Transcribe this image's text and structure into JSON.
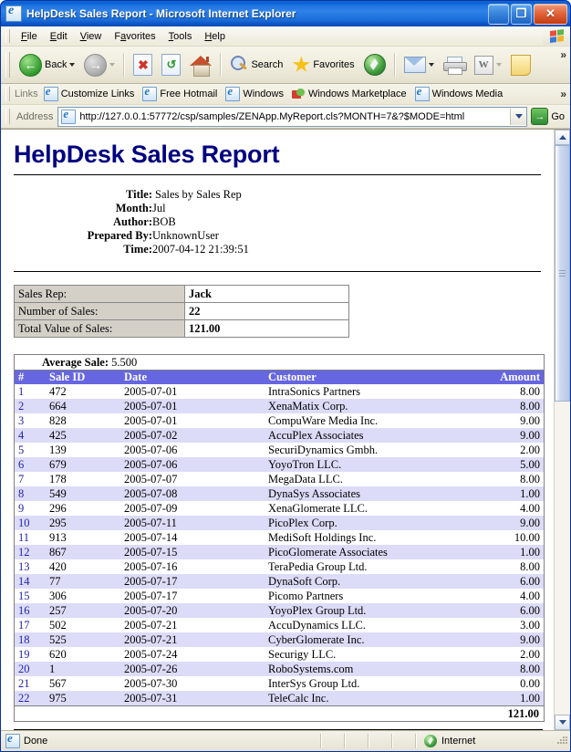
{
  "window": {
    "title": "HelpDesk Sales Report - Microsoft Internet Explorer",
    "minimize_label": "_",
    "maximize_label": "❐",
    "close_label": "✕"
  },
  "menubar": {
    "items": [
      {
        "label": "File",
        "accel": "F"
      },
      {
        "label": "Edit",
        "accel": "E"
      },
      {
        "label": "View",
        "accel": "V"
      },
      {
        "label": "Favorites",
        "accel": "a"
      },
      {
        "label": "Tools",
        "accel": "T"
      },
      {
        "label": "Help",
        "accel": "H"
      }
    ]
  },
  "linksbar": {
    "label": "Links",
    "items": [
      {
        "label": "Customize Links",
        "icon": "ie-page-icon"
      },
      {
        "label": "Free Hotmail",
        "icon": "ie-page-icon"
      },
      {
        "label": "Windows",
        "icon": "ie-page-icon"
      },
      {
        "label": "Windows Marketplace",
        "icon": "marketplace-icon"
      },
      {
        "label": "Windows Media",
        "icon": "ie-page-icon"
      }
    ],
    "overflow_label": "»"
  },
  "address": {
    "label": "Address",
    "url": "http://127.0.0.1:57772/csp/samples/ZENApp.MyReport.cls?MONTH=7&?$MODE=html",
    "go_label": "Go",
    "go_icon": "arrow-right-icon"
  },
  "toolbar": {
    "back_label": "Back",
    "search_label": "Search",
    "favorites_label": "Favorites",
    "overflow_label": "»"
  },
  "report": {
    "title": "HelpDesk Sales Report",
    "meta": [
      {
        "label": "Title:",
        "value": "Sales by Sales Rep"
      },
      {
        "label": "Month:",
        "value": "Jul"
      },
      {
        "label": "Author:",
        "value": "BOB"
      },
      {
        "label": "Prepared By:",
        "value": "UnknownUser"
      },
      {
        "label": "Time:",
        "value": "2007-04-12 21:39:51"
      }
    ],
    "summary": [
      {
        "key": "Sales Rep:",
        "value": "Jack"
      },
      {
        "key": "Number of Sales:",
        "value": "22"
      },
      {
        "key": "Total Value of Sales:",
        "value": "121.00"
      }
    ],
    "average_sale_label": "Average Sale:",
    "average_sale_value": "5.500",
    "columns": [
      "#",
      "Sale ID",
      "Date",
      "Customer",
      "Amount"
    ],
    "total_amount": "121.00",
    "header_bg": "#6666e0",
    "alt_row_bg": "#dcdcf8",
    "title_color": "#000080",
    "rows": [
      {
        "n": "1",
        "sale_id": "472",
        "date": "2005-07-01",
        "customer": "IntraSonics Partners",
        "amount": "8.00"
      },
      {
        "n": "2",
        "sale_id": "664",
        "date": "2005-07-01",
        "customer": "XenaMatix Corp.",
        "amount": "8.00"
      },
      {
        "n": "3",
        "sale_id": "828",
        "date": "2005-07-01",
        "customer": "CompuWare Media Inc.",
        "amount": "9.00"
      },
      {
        "n": "4",
        "sale_id": "425",
        "date": "2005-07-02",
        "customer": "AccuPlex Associates",
        "amount": "9.00"
      },
      {
        "n": "5",
        "sale_id": "139",
        "date": "2005-07-06",
        "customer": "SecuriDynamics Gmbh.",
        "amount": "2.00"
      },
      {
        "n": "6",
        "sale_id": "679",
        "date": "2005-07-06",
        "customer": "YoyoTron LLC.",
        "amount": "5.00"
      },
      {
        "n": "7",
        "sale_id": "178",
        "date": "2005-07-07",
        "customer": "MegaData LLC.",
        "amount": "8.00"
      },
      {
        "n": "8",
        "sale_id": "549",
        "date": "2005-07-08",
        "customer": "DynaSys Associates",
        "amount": "1.00"
      },
      {
        "n": "9",
        "sale_id": "296",
        "date": "2005-07-09",
        "customer": "XenaGlomerate LLC.",
        "amount": "4.00"
      },
      {
        "n": "10",
        "sale_id": "295",
        "date": "2005-07-11",
        "customer": "PicoPlex Corp.",
        "amount": "9.00"
      },
      {
        "n": "11",
        "sale_id": "913",
        "date": "2005-07-14",
        "customer": "MediSoft Holdings Inc.",
        "amount": "10.00"
      },
      {
        "n": "12",
        "sale_id": "867",
        "date": "2005-07-15",
        "customer": "PicoGlomerate Associates",
        "amount": "1.00"
      },
      {
        "n": "13",
        "sale_id": "420",
        "date": "2005-07-16",
        "customer": "TeraPedia Group Ltd.",
        "amount": "8.00"
      },
      {
        "n": "14",
        "sale_id": "77",
        "date": "2005-07-17",
        "customer": "DynaSoft Corp.",
        "amount": "6.00"
      },
      {
        "n": "15",
        "sale_id": "306",
        "date": "2005-07-17",
        "customer": "Picomo Partners",
        "amount": "4.00"
      },
      {
        "n": "16",
        "sale_id": "257",
        "date": "2005-07-20",
        "customer": "YoyoPlex Group Ltd.",
        "amount": "6.00"
      },
      {
        "n": "17",
        "sale_id": "502",
        "date": "2005-07-21",
        "customer": "AccuDynamics LLC.",
        "amount": "3.00"
      },
      {
        "n": "18",
        "sale_id": "525",
        "date": "2005-07-21",
        "customer": "CyberGlomerate Inc.",
        "amount": "9.00"
      },
      {
        "n": "19",
        "sale_id": "620",
        "date": "2005-07-24",
        "customer": "Securigy LLC.",
        "amount": "2.00"
      },
      {
        "n": "20",
        "sale_id": "1",
        "date": "2005-07-26",
        "customer": "RoboSystems.com",
        "amount": "8.00"
      },
      {
        "n": "21",
        "sale_id": "567",
        "date": "2005-07-30",
        "customer": "InterSys Group Ltd.",
        "amount": "0.00"
      },
      {
        "n": "22",
        "sale_id": "975",
        "date": "2005-07-31",
        "customer": "TeleCalc Inc.",
        "amount": "1.00"
      }
    ]
  },
  "statusbar": {
    "status": "Done",
    "zone": "Internet"
  }
}
